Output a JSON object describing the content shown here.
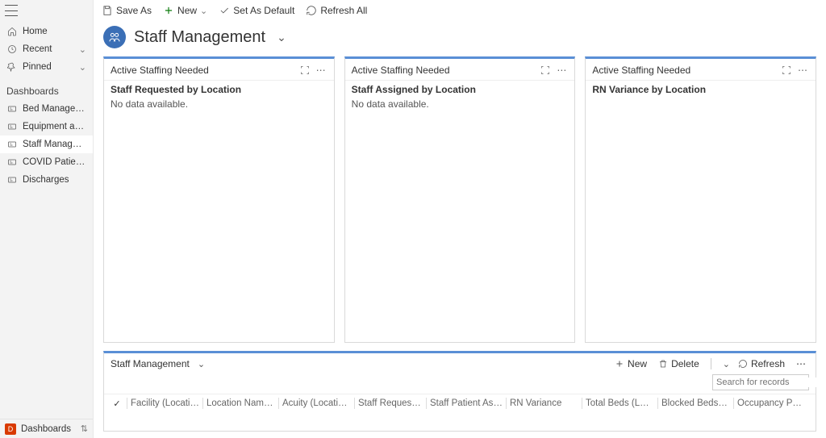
{
  "nav": {
    "home": "Home",
    "recent": "Recent",
    "pinned": "Pinned"
  },
  "section_header": "Dashboards",
  "dash_items": {
    "bed": "Bed Management",
    "equip": "Equipment and Supply",
    "staff": "Staff Management",
    "covid": "COVID Patients",
    "disch": "Discharges"
  },
  "footer": {
    "badge": "D",
    "label": "Dashboards"
  },
  "cmd": {
    "save_as": "Save As",
    "new": "New",
    "set_default": "Set As Default",
    "refresh_all": "Refresh All"
  },
  "page_title": "Staff Management",
  "cards": [
    {
      "title": "Active Staffing Needed",
      "subtitle": "Staff Requested by Location",
      "nodata": "No data available."
    },
    {
      "title": "Active Staffing Needed",
      "subtitle": "Staff Assigned by Location",
      "nodata": "No data available."
    },
    {
      "title": "Active Staffing Needed",
      "subtitle": "RN Variance by Location",
      "nodata": ""
    }
  ],
  "bottom": {
    "title": "Staff Management",
    "new": "New",
    "delete": "Delete",
    "refresh": "Refresh",
    "search_placeholder": "Search for records"
  },
  "cols": {
    "facility": "Facility (Location)",
    "loc_name": "Location Name (L...",
    "acuity": "Acuity (Location)",
    "staff_req": "Staff Requested",
    "staff_pa": "Staff Patient Assign",
    "rn_var": "RN Variance",
    "total_beds": "Total Beds (Locati...",
    "blocked": "Blocked Beds (Loc...",
    "occupancy": "Occupancy Percen..."
  }
}
